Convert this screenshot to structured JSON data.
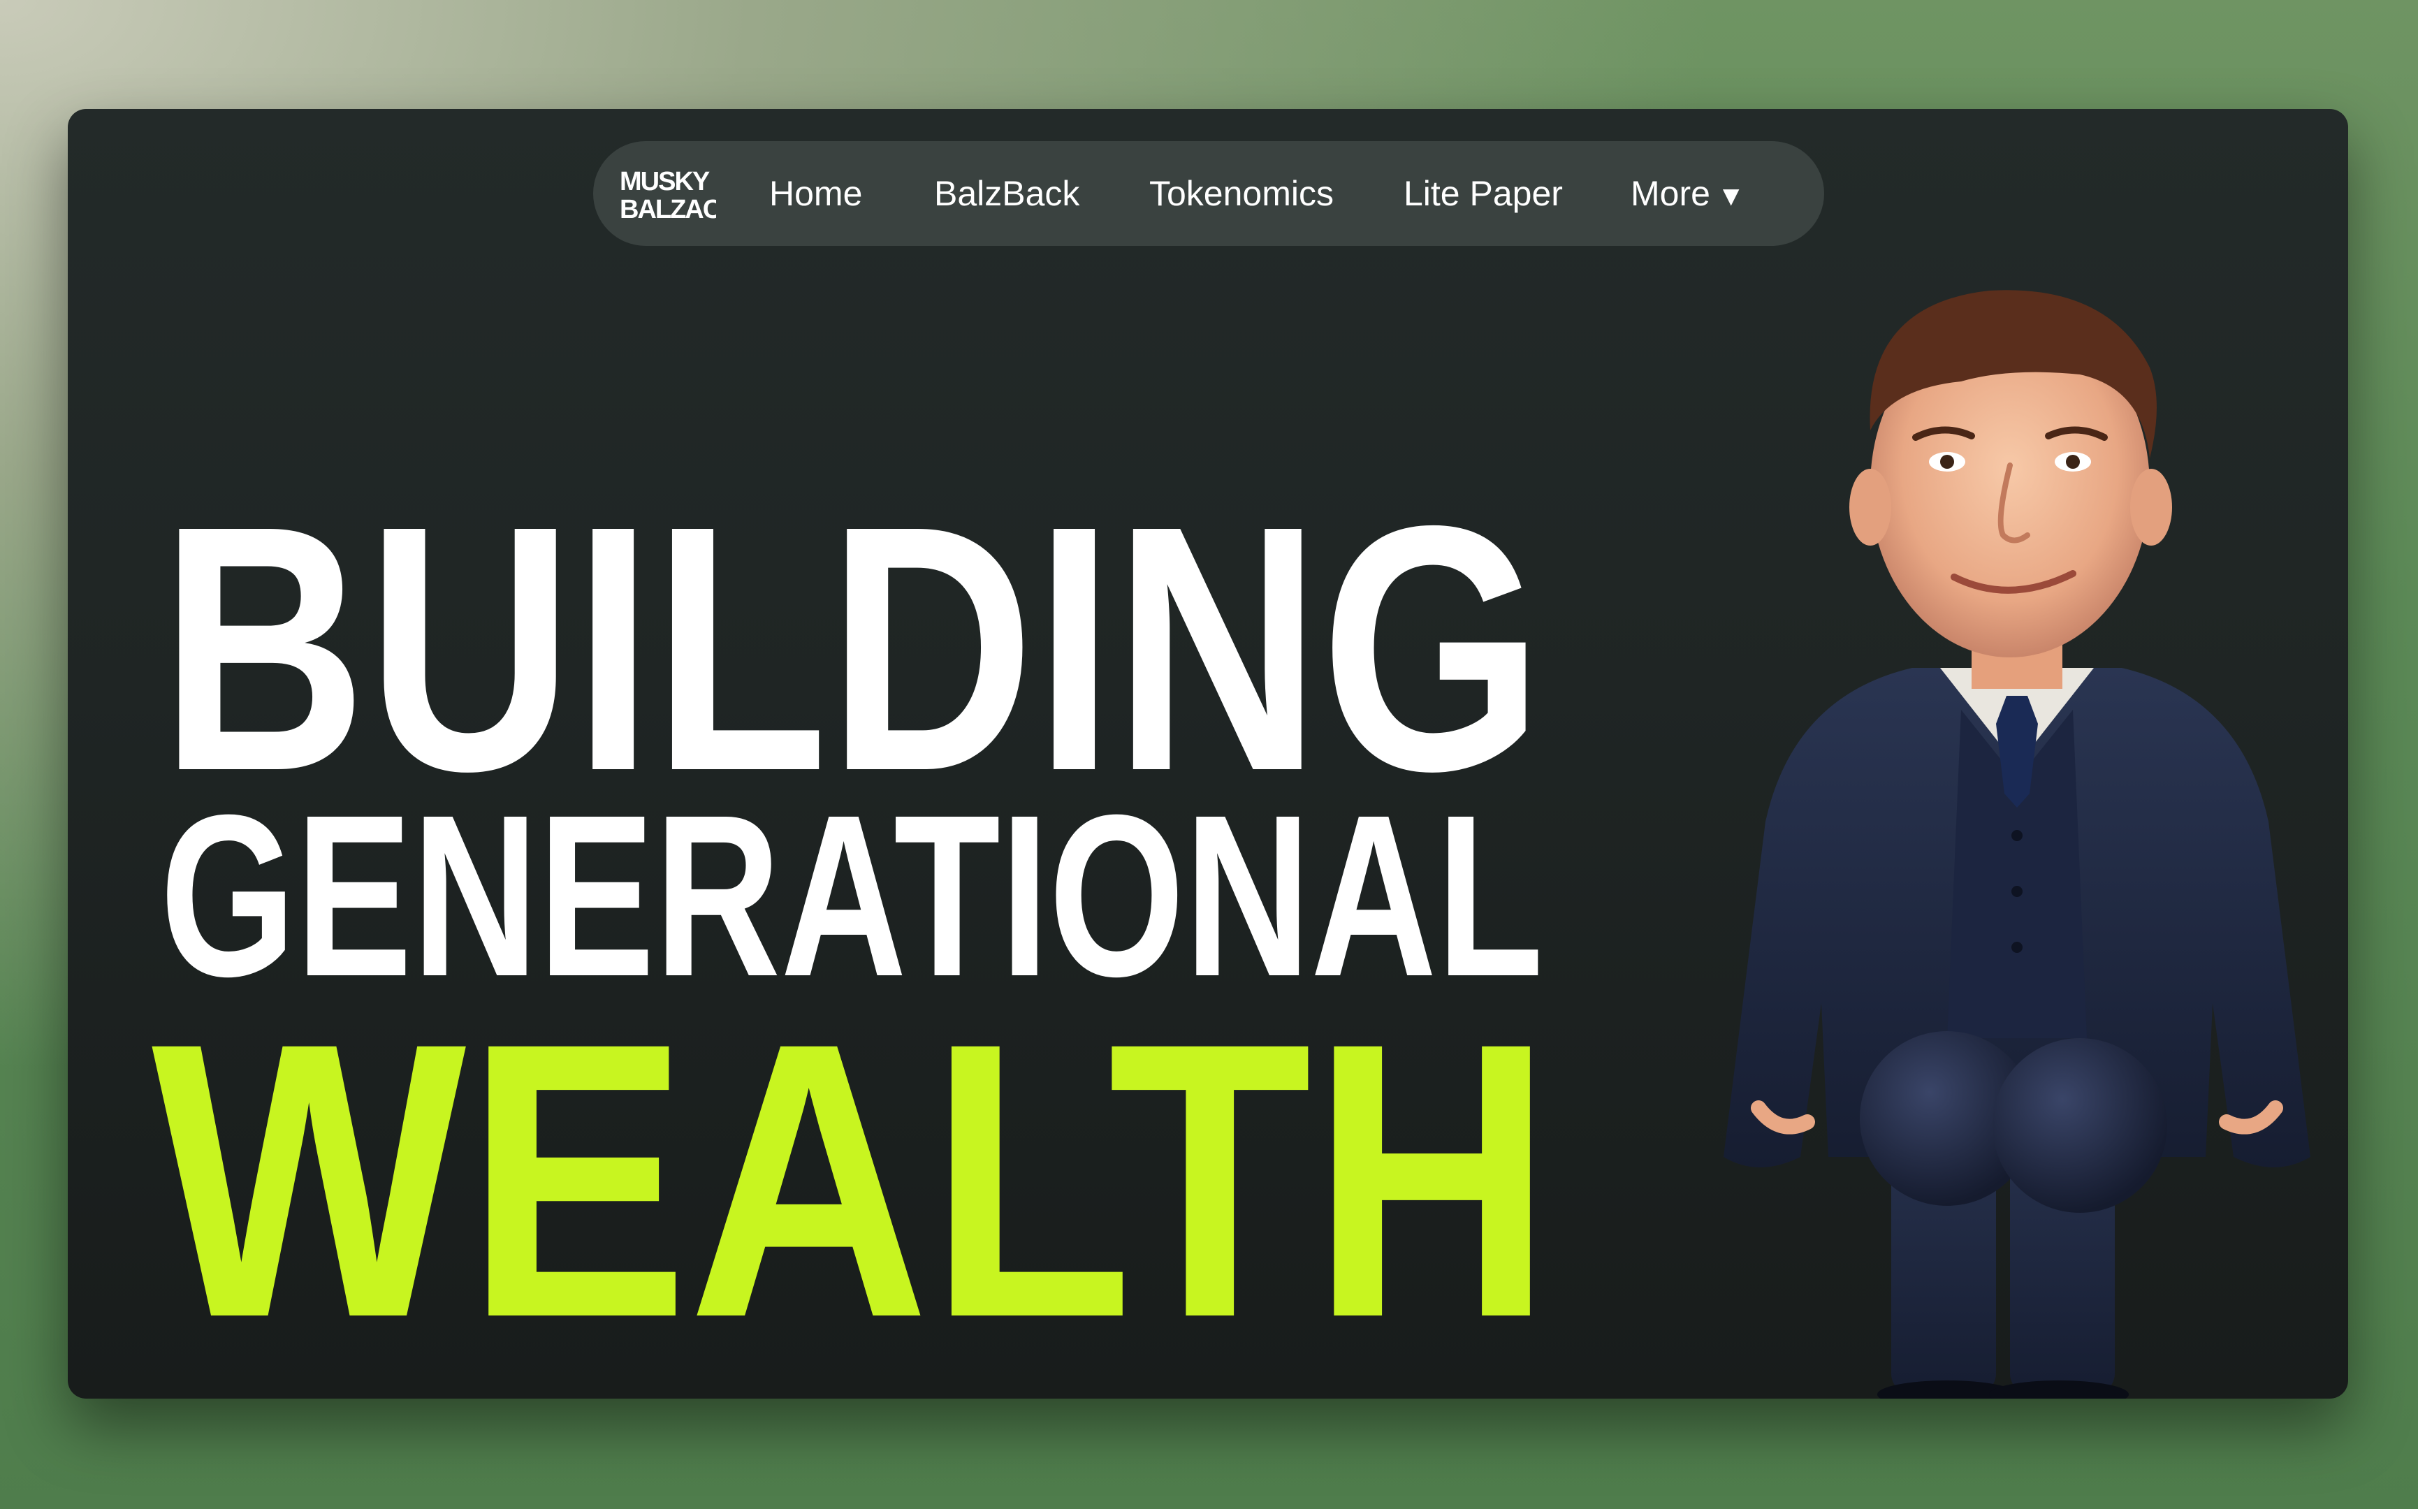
{
  "nav": {
    "logo_line1": "MUSKY",
    "logo_line2": "BALZAC",
    "items": [
      {
        "label": "Home"
      },
      {
        "label": "BalzBack"
      },
      {
        "label": "Tokenomics"
      },
      {
        "label": "Lite Paper"
      },
      {
        "label": "More"
      }
    ],
    "more_caret": "▼"
  },
  "hero": {
    "line1": "BUILDING",
    "line2": "GENERATIONAL",
    "line3": "WEALTH"
  },
  "colors": {
    "accent": "#c8f520",
    "headline": "#ffffff",
    "nav_bg": "#3a4240",
    "window_bg": "#1f2524"
  },
  "icons": {
    "logo": "musky-balzac-logo",
    "more_caret": "caret-down-icon"
  }
}
